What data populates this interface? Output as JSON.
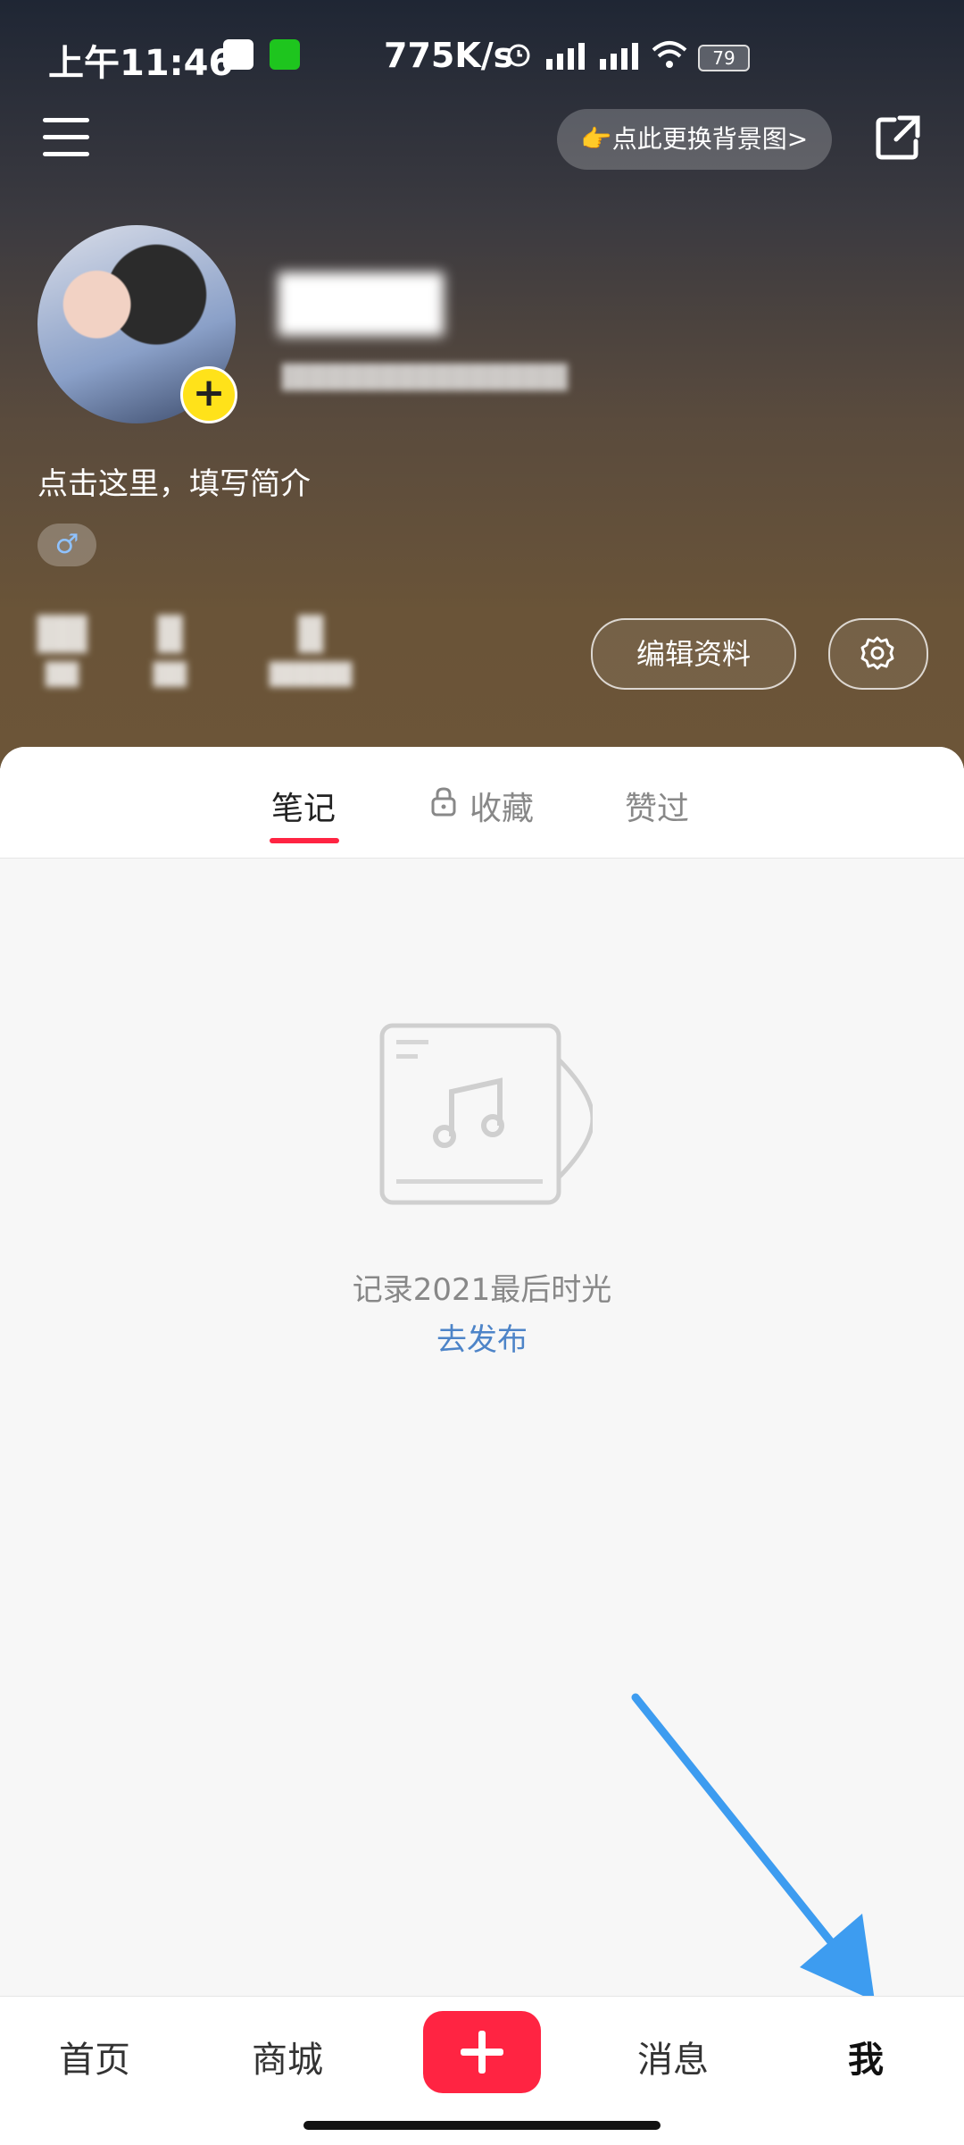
{
  "status_bar": {
    "time": "上午11:46",
    "net_speed": "775K/s",
    "battery": "79"
  },
  "header": {
    "change_bg_label": "👉点此更换背景图>"
  },
  "profile": {
    "bio_placeholder": "点击这里，填写简介",
    "gender_symbol": "♂",
    "edit_profile_label": "编辑资料"
  },
  "tabs": [
    {
      "label": "笔记",
      "active": true
    },
    {
      "label": "收藏",
      "locked": true
    },
    {
      "label": "赞过"
    }
  ],
  "empty_state": {
    "text": "记录2021最后时光",
    "action": "去发布"
  },
  "bottom_nav": {
    "items": [
      {
        "label": "首页"
      },
      {
        "label": "商城"
      },
      {
        "label": "消息"
      },
      {
        "label": "我",
        "active": true
      }
    ]
  },
  "colors": {
    "accent": "#ff2442",
    "link": "#4d84c8",
    "annotation_arrow": "#3d9cf0"
  }
}
